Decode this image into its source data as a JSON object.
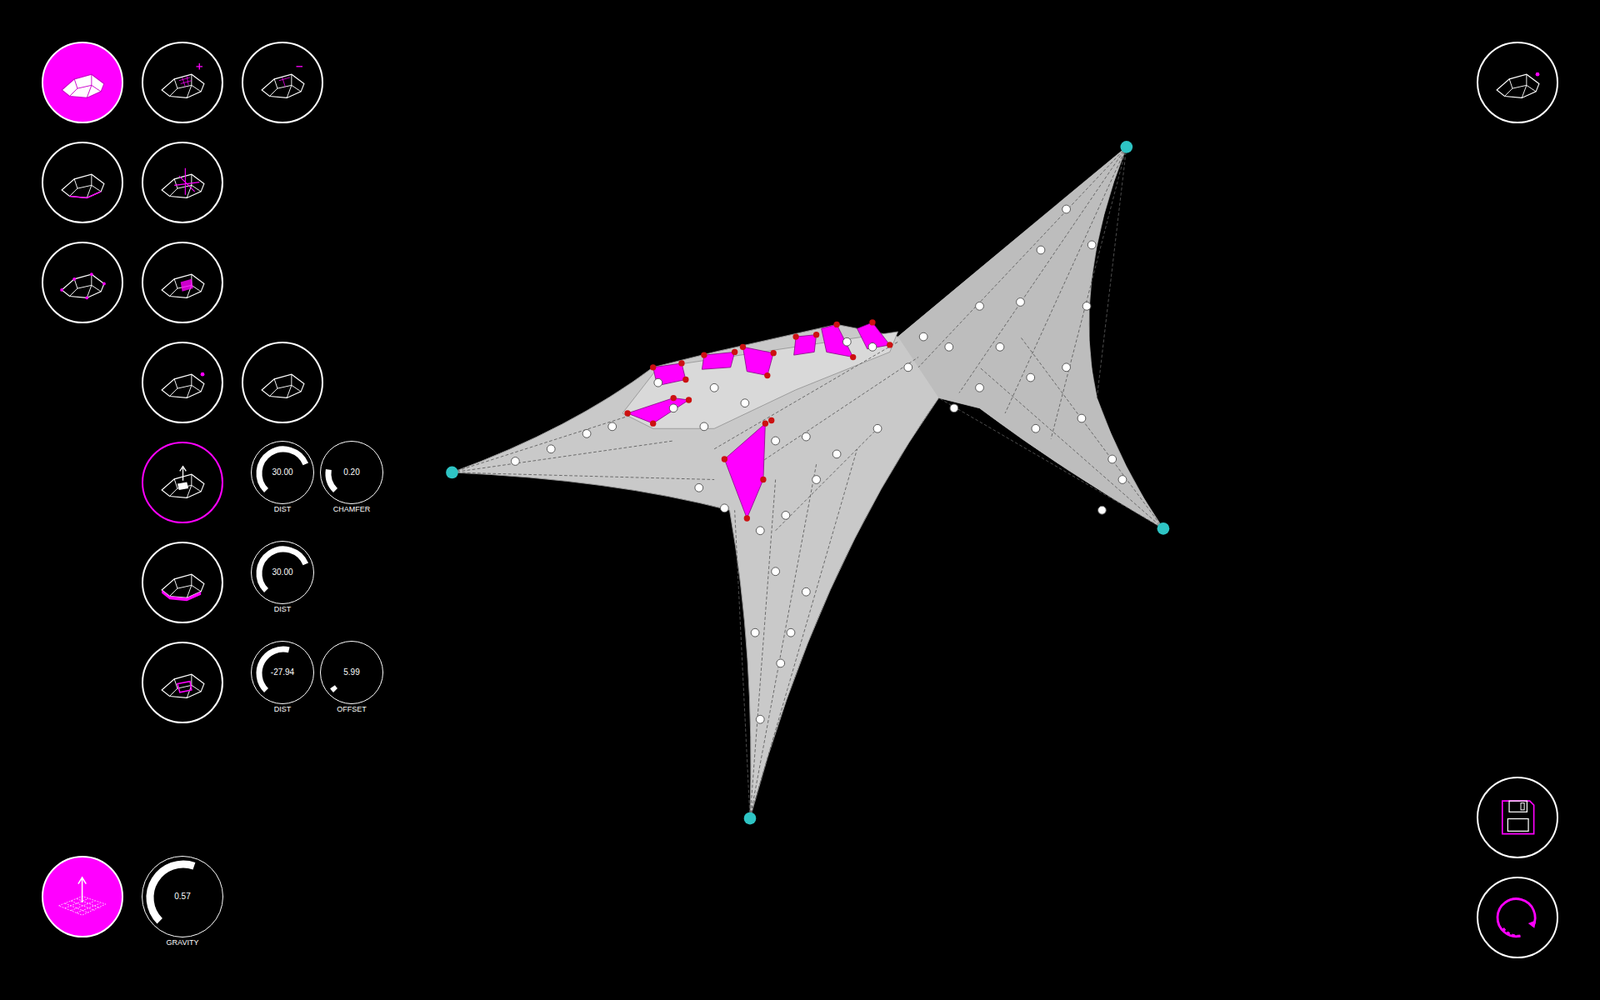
{
  "toolbar": {
    "main_tools": [
      [
        {
          "kind": "button",
          "selected": true,
          "highlighted": false
        },
        {
          "kind": "button",
          "selected": false,
          "highlighted": false
        },
        {
          "kind": "button",
          "selected": false,
          "highlighted": false
        }
      ],
      [
        {
          "kind": "button",
          "selected": false,
          "highlighted": false
        },
        {
          "kind": "button",
          "selected": false,
          "highlighted": false
        }
      ],
      [
        {
          "kind": "button",
          "selected": false,
          "highlighted": false
        },
        {
          "kind": "button",
          "selected": false,
          "highlighted": false
        }
      ]
    ],
    "sub_tools": [
      [
        {
          "kind": "button",
          "selected": false,
          "highlighted": false
        },
        {
          "kind": "button",
          "selected": false,
          "highlighted": false
        }
      ],
      [
        {
          "kind": "button",
          "selected": false,
          "highlighted": true
        },
        {
          "kind": "knob",
          "value": "30.00",
          "label": "DIST",
          "level": 0.75
        },
        {
          "kind": "knob",
          "value": "0.20",
          "label": "CHAMFER",
          "level": 0.2
        }
      ],
      [
        {
          "kind": "button",
          "selected": false,
          "highlighted": false
        },
        {
          "kind": "knob",
          "value": "30.00",
          "label": "DIST",
          "level": 0.75
        }
      ],
      [
        {
          "kind": "button",
          "selected": false,
          "highlighted": false
        },
        {
          "kind": "knob",
          "value": "-27.94",
          "label": "DIST",
          "level": 0.55
        },
        {
          "kind": "knob",
          "value": "5.99",
          "label": "OFFSET",
          "level": 0.04
        }
      ]
    ],
    "gravity": {
      "button": {
        "selected": true
      },
      "knob": {
        "value": "0.57",
        "label": "GRAVITY",
        "level": 0.57
      }
    }
  },
  "view_button": {
    "selected": false
  },
  "file_buttons": [
    {
      "kind": "save"
    },
    {
      "kind": "refresh"
    }
  ]
}
